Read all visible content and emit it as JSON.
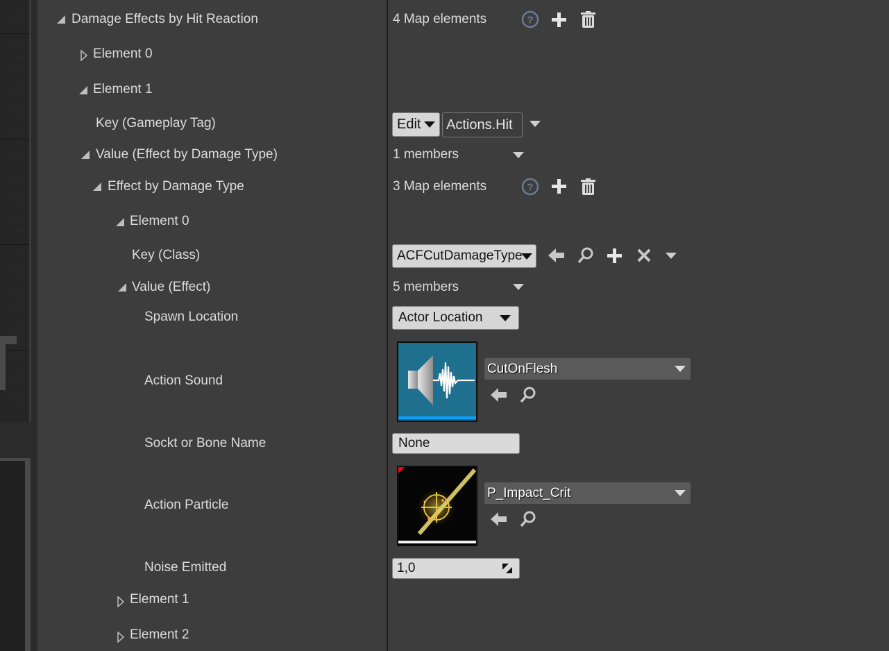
{
  "tree": {
    "root": {
      "label": "Damage Effects by Hit Reaction",
      "value": "4 Map elements"
    },
    "element_0": {
      "label": "Element 0"
    },
    "element_1": {
      "label": "Element 1"
    },
    "key_gameplay_tag": {
      "label": "Key (Gameplay Tag)",
      "edit_label": "Edit",
      "tag_value": "Actions.Hit"
    },
    "value_effect_by_damage_type": {
      "label": "Value (Effect by Damage Type)",
      "value": "1 members"
    },
    "effect_by_damage_type": {
      "label": "Effect by Damage Type",
      "value": "3 Map elements"
    },
    "inner_element_0": {
      "label": "Element 0"
    },
    "key_class": {
      "label": "Key (Class)",
      "value": "ACFCutDamageType"
    },
    "value_effect": {
      "label": "Value (Effect)",
      "value": "5 members"
    },
    "spawn_location": {
      "label": "Spawn Location",
      "value": "Actor Location"
    },
    "action_sound": {
      "label": "Action Sound",
      "asset": "CutOnFlesh"
    },
    "socket_bone": {
      "label": "Sockt or Bone Name",
      "value": "None"
    },
    "action_particle": {
      "label": "Action Particle",
      "asset": "P_Impact_Crit"
    },
    "noise_emitted": {
      "label": "Noise Emitted",
      "value": "1,0"
    },
    "inner_element_1": {
      "label": "Element 1"
    },
    "inner_element_2": {
      "label": "Element 2"
    }
  },
  "icons": {
    "help": "help-icon",
    "add": "add-icon",
    "delete": "trash-icon",
    "use_selected": "arrow-left-icon",
    "browse": "search-icon",
    "clear": "close-icon"
  },
  "colors": {
    "panel_bg": "#3d3d3d",
    "text": "#dcdcdc",
    "sound_thumb_bg": "#1f6f8f",
    "sound_bar": "#0aa0ff"
  }
}
